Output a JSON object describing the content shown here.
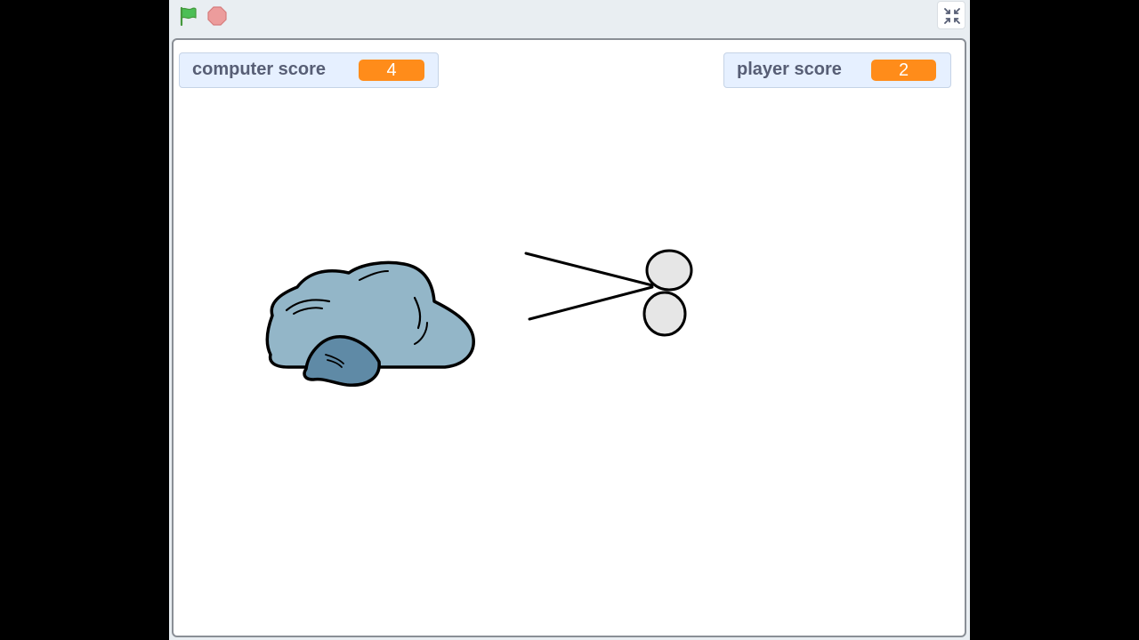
{
  "toolbar": {
    "green_flag_icon": "green-flag-icon",
    "stop_icon": "stop-sign-icon",
    "fullscreen_icon": "unfullscreen-icon"
  },
  "monitors": {
    "computer_score": {
      "label": "computer score",
      "value": "4"
    },
    "player_score": {
      "label": "player score",
      "value": "2"
    }
  },
  "sprites": {
    "rock": "rock-sprite",
    "scissors": "scissors-sprite"
  },
  "colors": {
    "monitor_value_bg": "#ff8c1a",
    "monitor_bg": "#e6f0ff",
    "flag_green": "#4cbf56",
    "stop_red": "#ec9c9c",
    "rock_light": "#93b6c8",
    "rock_dark": "#5f8aa6"
  }
}
